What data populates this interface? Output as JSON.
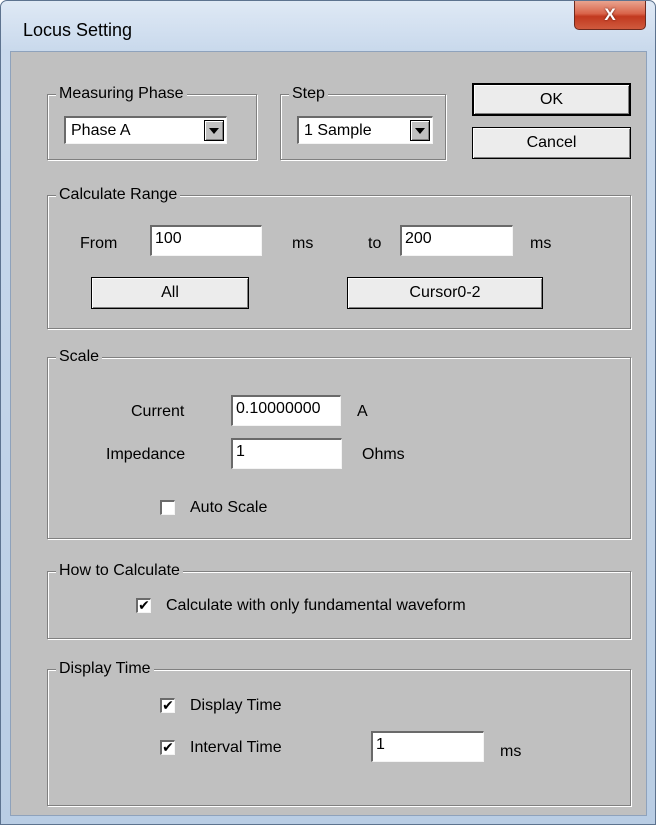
{
  "window": {
    "title": "Locus Setting",
    "close_glyph": "X"
  },
  "measuring_phase": {
    "group_label": "Measuring Phase",
    "selected": "Phase A"
  },
  "step": {
    "group_label": "Step",
    "selected": "1 Sample"
  },
  "buttons": {
    "ok": "OK",
    "cancel": "Cancel",
    "all": "All",
    "cursor": "Cursor0-2"
  },
  "calculate_range": {
    "group_label": "Calculate Range",
    "from_label": "From",
    "from_value": "100",
    "from_unit": "ms",
    "to_label": "to",
    "to_value": "200",
    "to_unit": "ms"
  },
  "scale": {
    "group_label": "Scale",
    "current_label": "Current",
    "current_value": "0.10000000",
    "current_unit": "A",
    "impedance_label": "Impedance",
    "impedance_value": "1",
    "impedance_unit": "Ohms",
    "auto_scale_label": "Auto Scale",
    "auto_scale_checked": false
  },
  "how_to_calculate": {
    "group_label": "How to Calculate",
    "fundamental_label": "Calculate with only fundamental waveform",
    "fundamental_checked": true
  },
  "display_time": {
    "group_label": "Display Time",
    "display_time_label": "Display Time",
    "display_time_checked": true,
    "interval_label": "Interval Time",
    "interval_checked": true,
    "interval_value": "1",
    "interval_unit": "ms"
  },
  "icons": {
    "check": "checkmark-icon",
    "dropdown": "chevron-down-icon",
    "close": "close-icon"
  }
}
